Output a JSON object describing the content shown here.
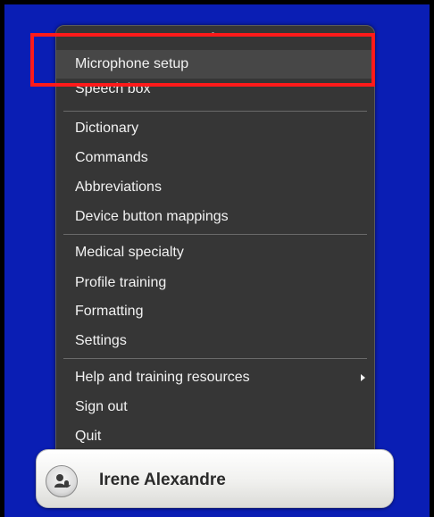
{
  "menu": {
    "items": [
      {
        "label": "Microphone setup"
      },
      {
        "label": "Speech box"
      },
      {
        "label": "Dictionary"
      },
      {
        "label": "Commands"
      },
      {
        "label": "Abbreviations"
      },
      {
        "label": "Device button mappings"
      },
      {
        "label": "Medical specialty"
      },
      {
        "label": "Profile training"
      },
      {
        "label": "Formatting"
      },
      {
        "label": "Settings"
      },
      {
        "label": "Help and training resources"
      },
      {
        "label": "Sign out"
      },
      {
        "label": "Quit"
      }
    ]
  },
  "user": {
    "name": "Irene Alexandre"
  },
  "colors": {
    "background": "#0a1eb4",
    "menu": "#363636",
    "highlight": "#ff1a1a"
  },
  "icons": {
    "user": "microphone-person-icon",
    "submenu": "triangle-right-icon"
  }
}
